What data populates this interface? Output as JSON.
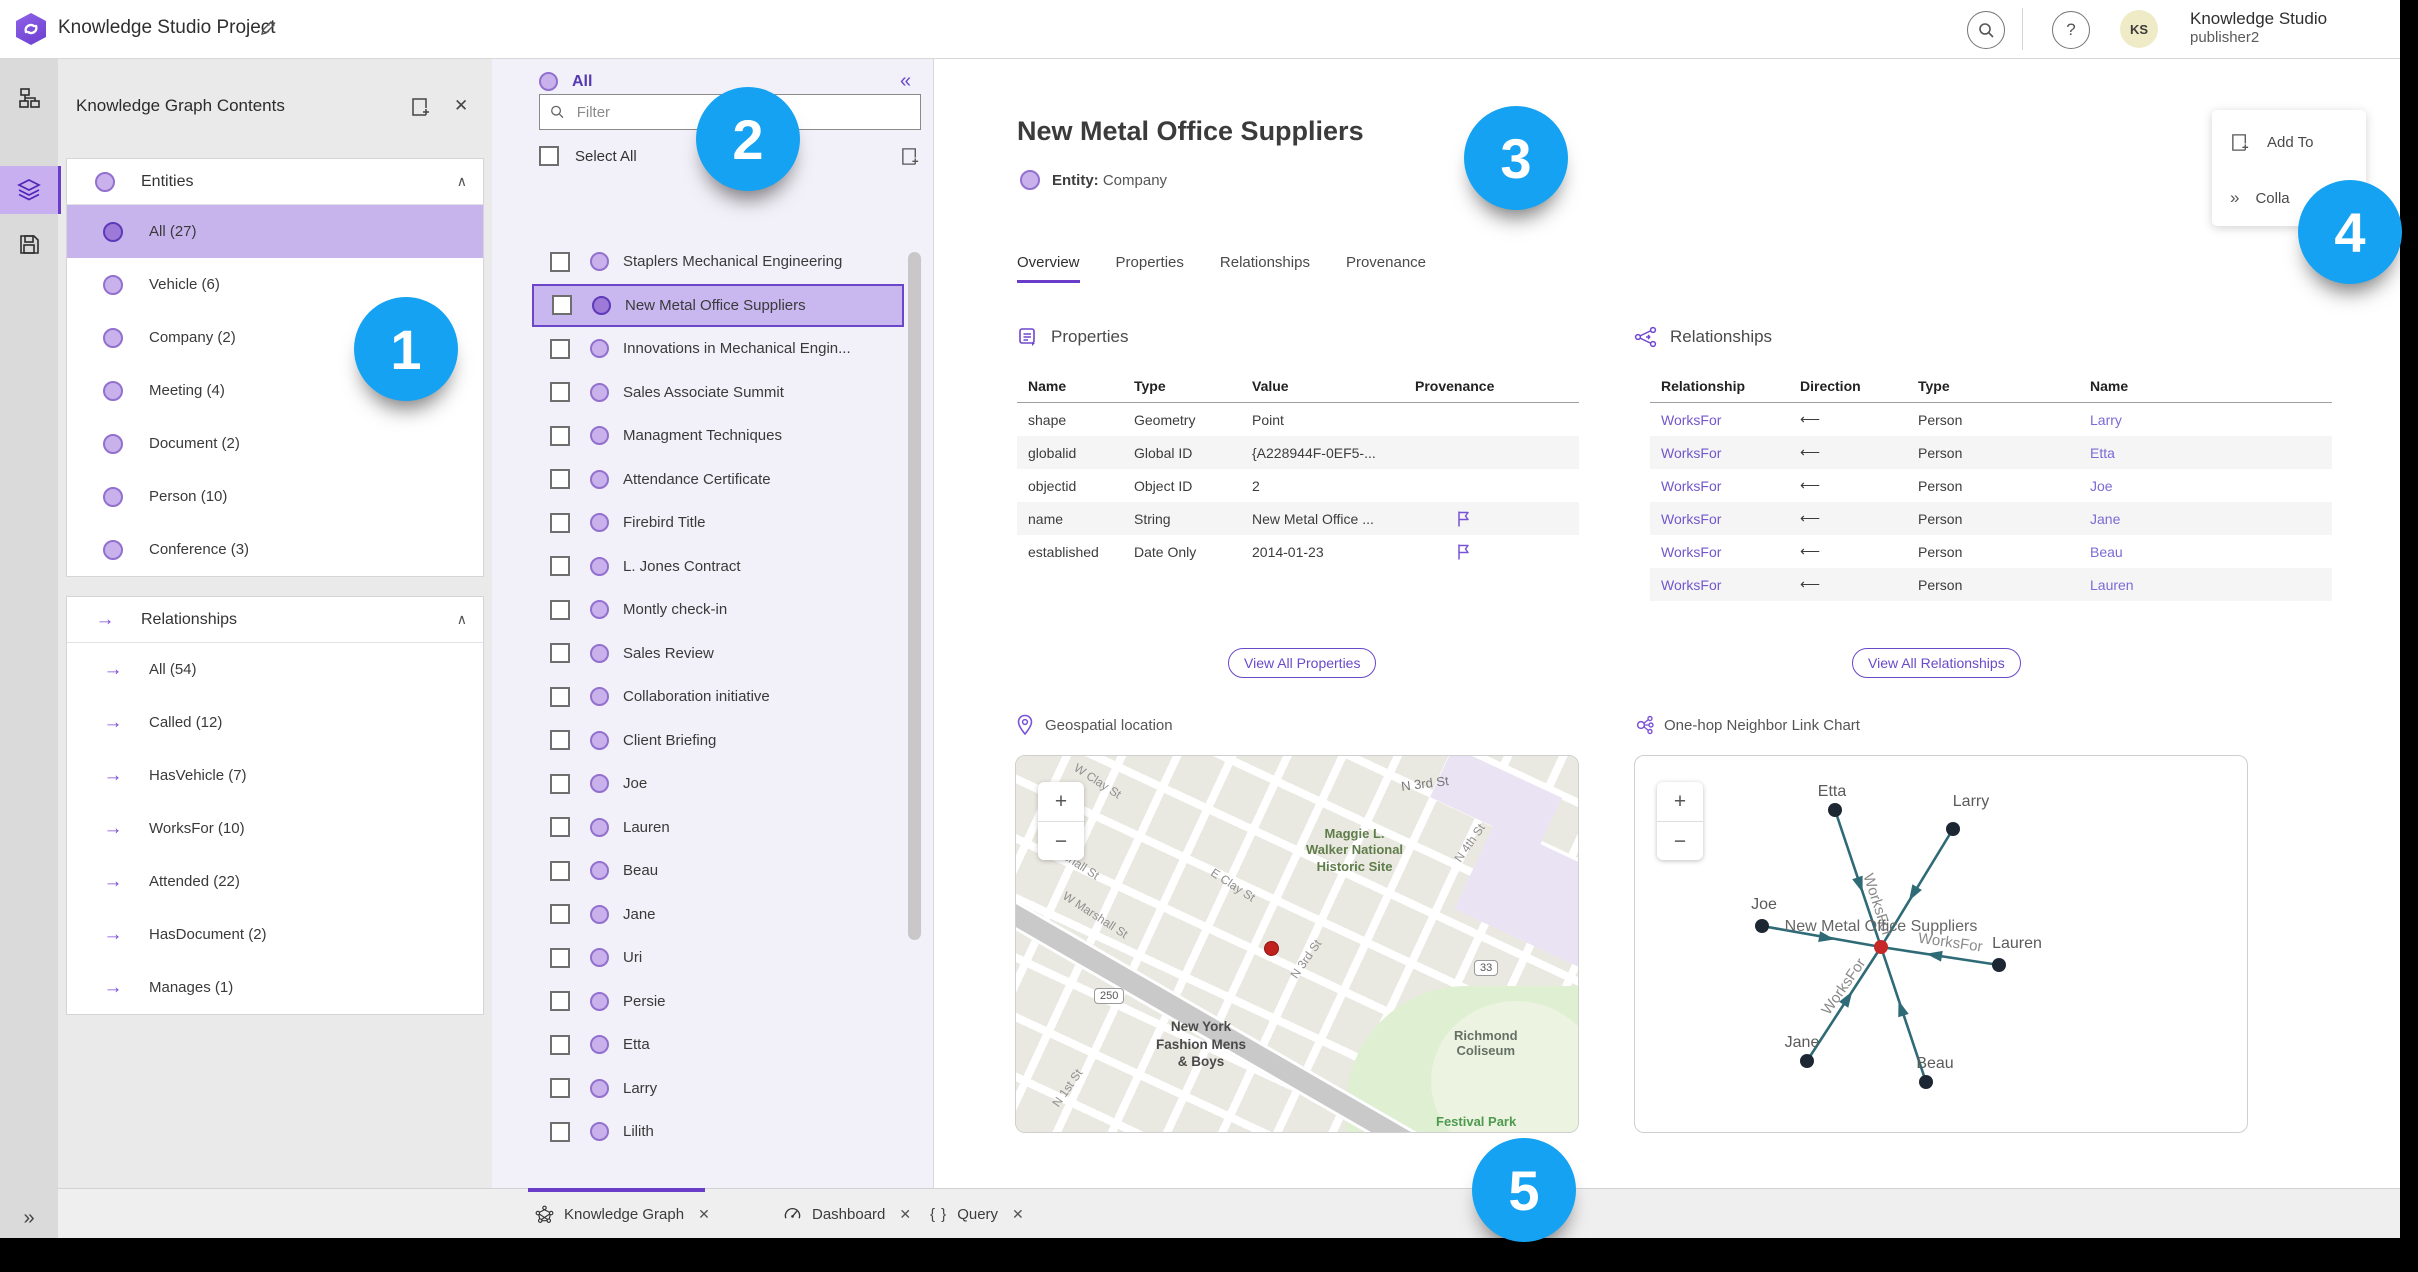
{
  "header": {
    "app_title": "Knowledge Studio Project",
    "avatar_initials": "KS",
    "org_name": "Knowledge Studio",
    "user_name": "publisher2",
    "help_glyph": "?"
  },
  "icons": {
    "collapse_left": "«",
    "expand_right": "»",
    "chevron_up": "∧",
    "close": "✕",
    "minus": "−",
    "plus": "+",
    "query_braces": "{ }"
  },
  "contents_panel": {
    "title": "Knowledge Graph Contents",
    "entities": {
      "label": "Entities",
      "items": [
        "All (27)",
        "Vehicle (6)",
        "Company (2)",
        "Meeting (4)",
        "Document (2)",
        "Person (10)",
        "Conference (3)"
      ]
    },
    "relationships": {
      "label": "Relationships",
      "items": [
        "All (54)",
        "Called (12)",
        "HasVehicle (7)",
        "WorksFor (10)",
        "Attended (22)",
        "HasDocument (2)",
        "Manages (1)"
      ]
    }
  },
  "list_panel": {
    "header": "All",
    "filter_placeholder": "Filter",
    "select_all": "Select All",
    "items": [
      "Staplers Mechanical Engineering",
      "New Metal Office Suppliers",
      "Innovations in Mechanical Engin...",
      "Sales Associate Summit",
      "Managment Techniques",
      "Attendance Certificate",
      "Firebird Title",
      "L. Jones Contract",
      "Montly check-in",
      "Sales Review",
      "Collaboration initiative",
      "Client Briefing",
      "Joe",
      "Lauren",
      "Beau",
      "Jane",
      "Uri",
      "Persie",
      "Etta",
      "Larry",
      "Lilith"
    ]
  },
  "detail": {
    "title": "New Metal Office Suppliers",
    "entity_label": "Entity:",
    "entity_type": "Company",
    "tabs": [
      "Overview",
      "Properties",
      "Relationships",
      "Provenance"
    ],
    "properties": {
      "heading": "Properties",
      "headers": [
        "Name",
        "Type",
        "Value",
        "Provenance"
      ],
      "rows": [
        {
          "name": "shape",
          "type": "Geometry",
          "value": "Point"
        },
        {
          "name": "globalid",
          "type": "Global ID",
          "value": "{A228944F-0EF5-..."
        },
        {
          "name": "objectid",
          "type": "Object ID",
          "value": "2"
        },
        {
          "name": "name",
          "type": "String",
          "value": "New Metal Office ..."
        },
        {
          "name": "established",
          "type": "Date Only",
          "value": "2014-01-23"
        }
      ],
      "view_all": "View All Properties"
    },
    "relationships": {
      "heading": "Relationships",
      "headers": [
        "Relationship",
        "Direction",
        "Type",
        "Name"
      ],
      "rows": [
        {
          "rel": "WorksFor",
          "dir": "⟵",
          "type": "Person",
          "name": "Larry"
        },
        {
          "rel": "WorksFor",
          "dir": "⟵",
          "type": "Person",
          "name": "Etta"
        },
        {
          "rel": "WorksFor",
          "dir": "⟵",
          "type": "Person",
          "name": "Joe"
        },
        {
          "rel": "WorksFor",
          "dir": "⟵",
          "type": "Person",
          "name": "Jane"
        },
        {
          "rel": "WorksFor",
          "dir": "⟵",
          "type": "Person",
          "name": "Beau"
        },
        {
          "rel": "WorksFor",
          "dir": "⟵",
          "type": "Person",
          "name": "Lauren"
        }
      ],
      "view_all": "View All Relationships"
    },
    "map": {
      "heading": "Geospatial location",
      "labels": {
        "w_clay": "W Clay St",
        "n3rd_top": "N 3rd St",
        "n4th": "N 4th St",
        "maggie": "Maggie L.\nWalker National\nHistoric Site",
        "marshall": "arshall St",
        "e_clay": "E Clay St",
        "w_marshall": "W Marshall St",
        "n3rd_mid": "N 3rd St",
        "nyfashion": "New York\nFashion Mens\n& Boys",
        "coliseum": "Richmond\nColiseum",
        "n1st": "N 1st St",
        "festival": "Festival Park",
        "shield_250": "250",
        "shield_33": "33"
      }
    },
    "link_chart": {
      "heading": "One-hop Neighbor Link Chart",
      "center_label": "New Metal Office Suppliers",
      "edge_label": "WorksFor",
      "nodes": [
        "Etta",
        "Larry",
        "Joe",
        "Lauren",
        "Jane",
        "Beau"
      ]
    }
  },
  "overlay_panel": {
    "add_to": "Add To",
    "collapse": "Colla"
  },
  "bottom_tabs": [
    {
      "label": "Knowledge Graph",
      "close": "✕"
    },
    {
      "label": "Dashboard",
      "close": "✕"
    },
    {
      "label": "Query",
      "close": "✕"
    }
  ],
  "callouts": [
    "1",
    "2",
    "3",
    "4",
    "5"
  ],
  "colors": {
    "accent_purple": "#6a3dc8",
    "selection_fill": "#c9b7f0",
    "callout_blue": "#15a2f3",
    "edge_teal": "#2e6b77",
    "node_navy": "#1c2733",
    "marker_red": "#c1211c"
  }
}
